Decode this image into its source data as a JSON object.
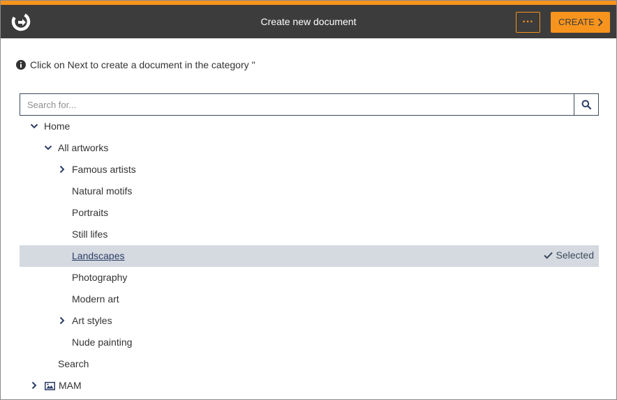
{
  "header": {
    "title": "Create new document",
    "more_label": "···",
    "create_label": "CREATE"
  },
  "info": {
    "text": "Click on Next to create a document in the category ''"
  },
  "search": {
    "placeholder": "Search for..."
  },
  "tree": {
    "home": "Home",
    "all_artworks": "All artworks",
    "famous_artists": "Famous artists",
    "natural_motifs": "Natural motifs",
    "portraits": "Portraits",
    "still_lifes": "Still lifes",
    "landscapes": "Landscapes",
    "selected_label": "Selected",
    "photography": "Photography",
    "modern_art": "Modern art",
    "art_styles": "Art styles",
    "nude_painting": "Nude painting",
    "search": "Search",
    "mam": "MAM"
  },
  "colors": {
    "accent": "#f7941d",
    "header_bg": "#3c3c3c",
    "selected_bg": "#d5d9e0",
    "border": "#3a4a5c"
  }
}
